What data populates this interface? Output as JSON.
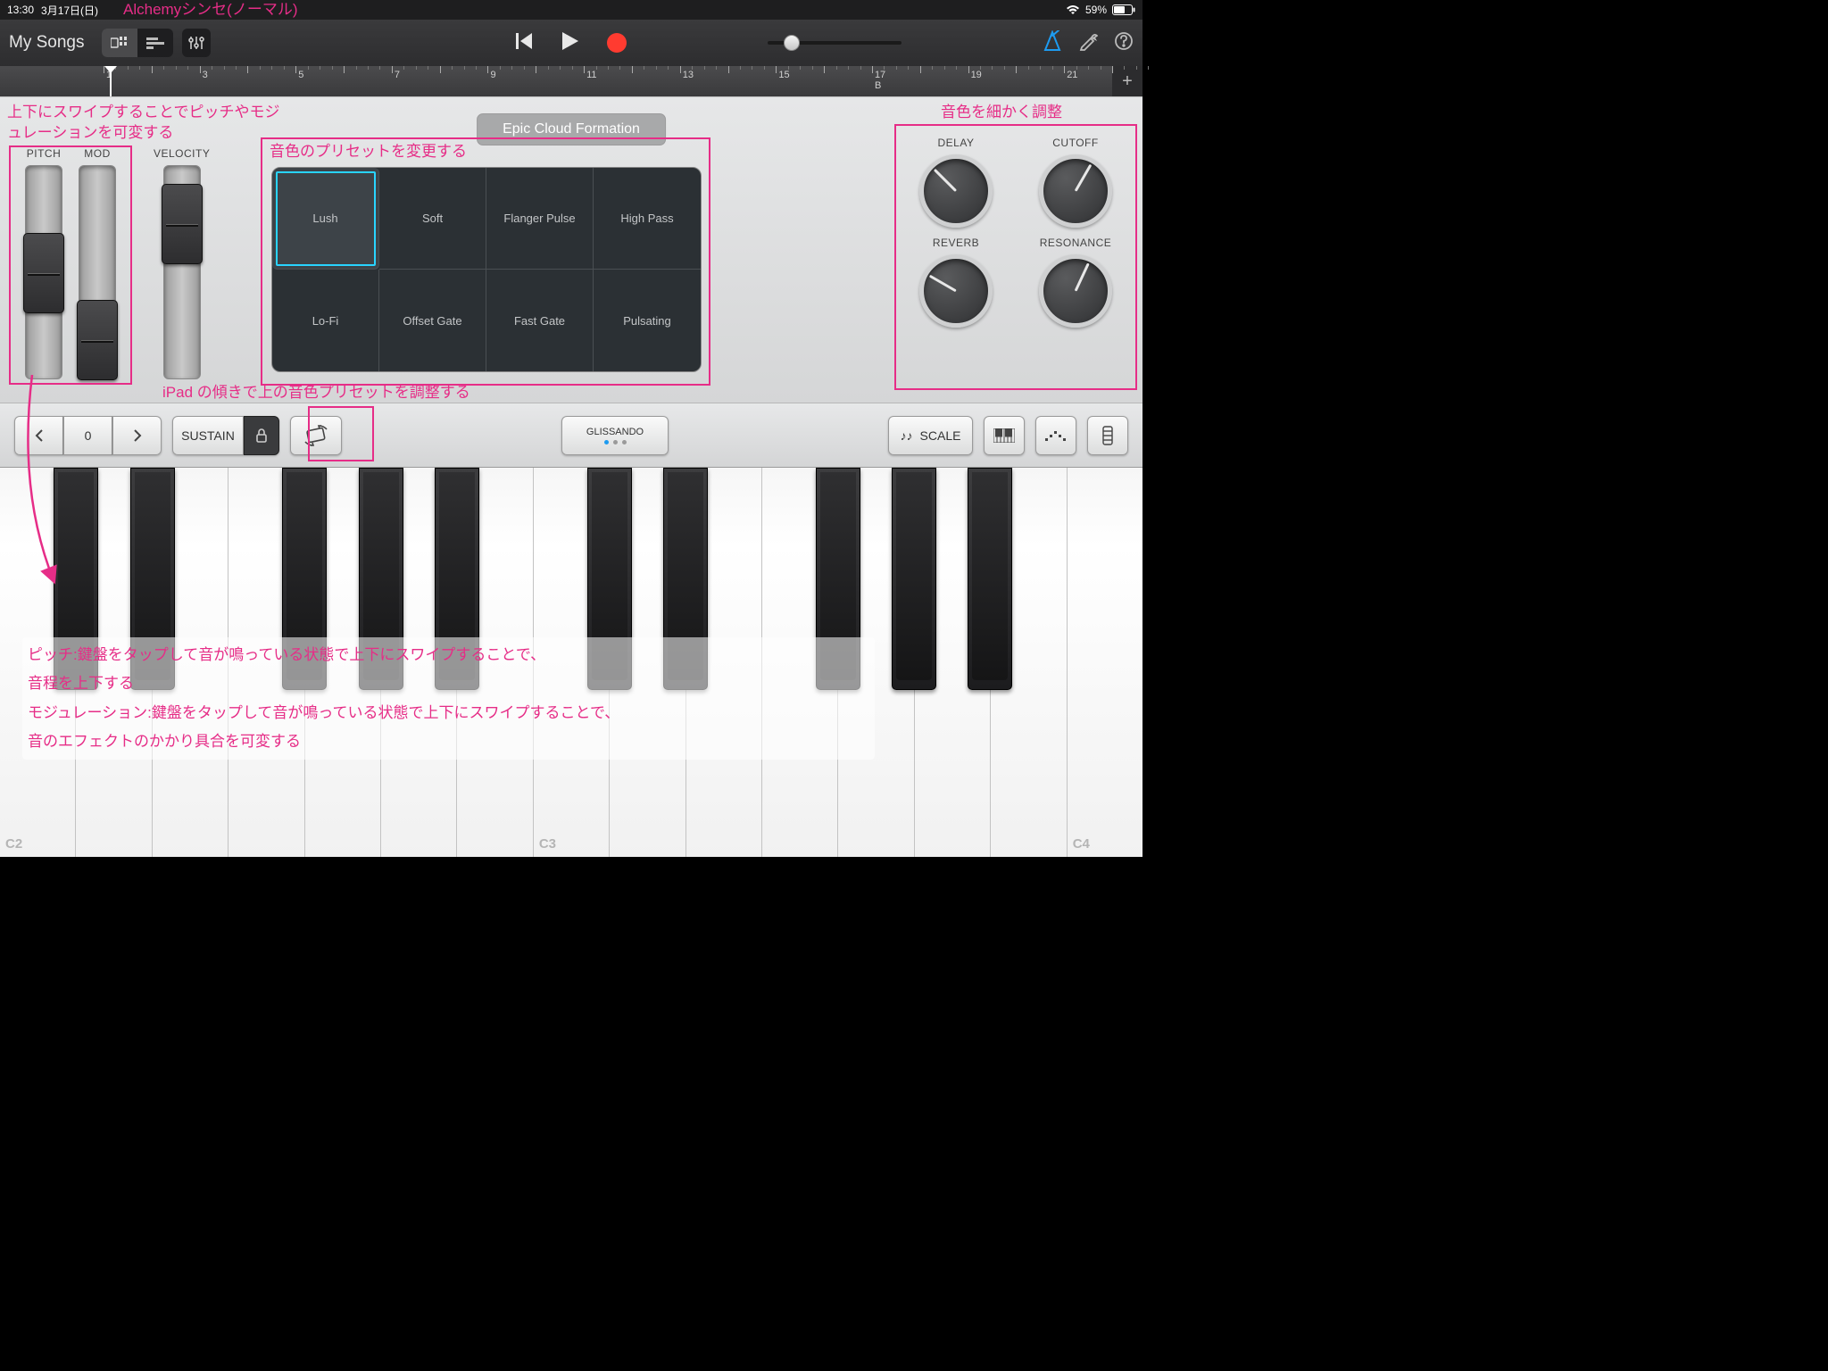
{
  "status": {
    "time": "13:30",
    "date": "3月17日(日)",
    "battery_pct": "59%"
  },
  "annotations": {
    "title": "Alchemyシンセ(ノーマル)",
    "pitch_mod": "上下にスワイプすることでピッチやモジュレーションを可変する",
    "preset_change": "音色のプリセットを変更する",
    "knobs": "音色を細かく調整",
    "tilt": "iPad の傾きで上の音色プリセットを調整する",
    "overlay_l1": "ピッチ:鍵盤をタップして音が鳴っている状態で上下にスワイプすることで、",
    "overlay_l2": "音程を上下する",
    "overlay_l3": "モジュレーション:鍵盤をタップして音が鳴っている状態で上下にスワイプすることで、",
    "overlay_l4": "音のエフェクトのかかり具合を可変する"
  },
  "toolbar": {
    "back": "My Songs"
  },
  "ruler": {
    "bars": [
      "1",
      "3",
      "5",
      "7",
      "9",
      "11",
      "13",
      "15",
      "17",
      "19",
      "21"
    ],
    "marker": "B"
  },
  "panel": {
    "sliders": {
      "pitch": "PITCH",
      "mod": "MOD",
      "velocity": "VELOCITY"
    },
    "preset_name": "Epic Cloud Formation",
    "presets": [
      "Lush",
      "Soft",
      "Flanger Pulse",
      "High Pass",
      "Lo-Fi",
      "Offset Gate",
      "Fast Gate",
      "Pulsating"
    ],
    "selected_preset_index": 0,
    "knobs": {
      "delay": "DELAY",
      "cutoff": "CUTOFF",
      "reverb": "REVERB",
      "resonance": "RESONANCE"
    }
  },
  "kb_toolbar": {
    "octave_value": "0",
    "sustain": "SUSTAIN",
    "glissando": "GLISSANDO",
    "scale": "SCALE"
  },
  "piano": {
    "labels": [
      "C2",
      "C3",
      "C4"
    ]
  }
}
